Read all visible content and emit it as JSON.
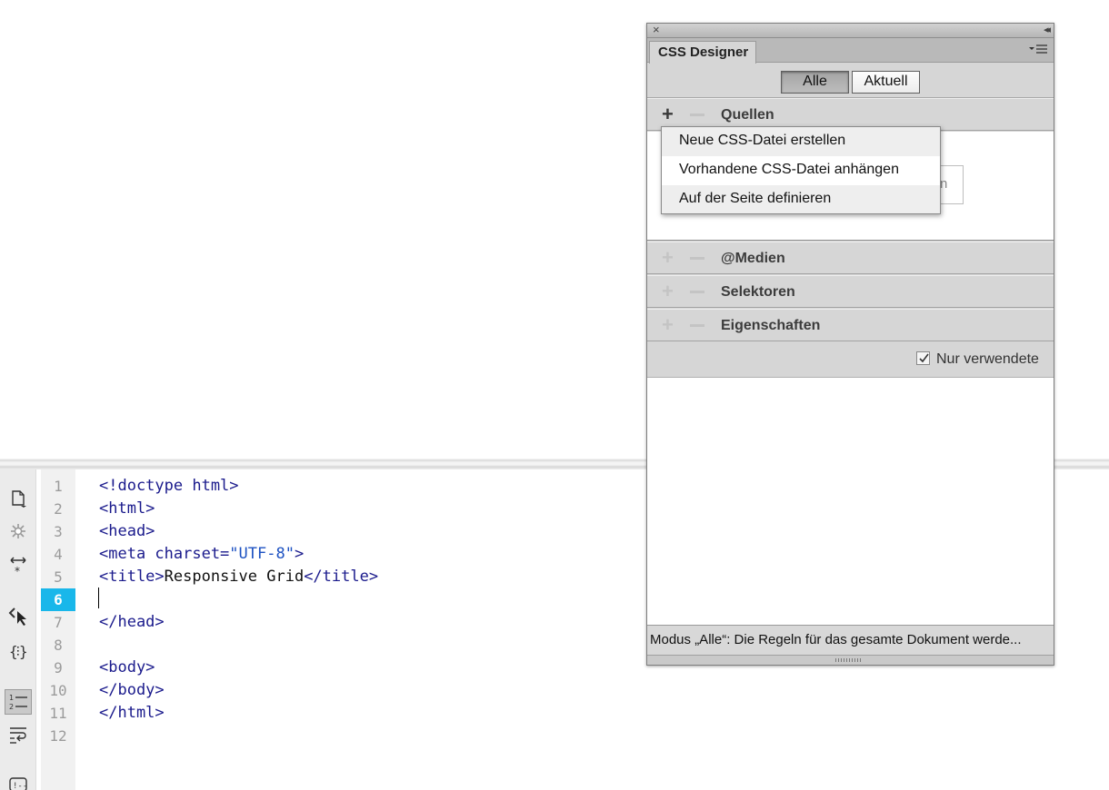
{
  "editor": {
    "line_numbers": [
      "1",
      "2",
      "3",
      "4",
      "5",
      "6",
      "7",
      "8",
      "9",
      "10",
      "11",
      "12"
    ],
    "current_line": "6",
    "code": {
      "l1": "<!doctype html>",
      "l2": "<html>",
      "l3": "<head>",
      "l4_tag_open": "<meta charset=",
      "l4_value": "\"UTF-8\"",
      "l4_tag_close": ">",
      "l5_open": "<title>",
      "l5_text": "Responsive Grid",
      "l5_close": "</title>",
      "l7": "</head>",
      "l9": "<body>",
      "l10": "</body>",
      "l11": "</html>"
    },
    "toolbar_icons": [
      "open-documents-icon",
      "collapse-tag-icon",
      "expand-all-icon",
      "select-parent-tag-icon",
      "balance-braces-icon",
      "line-numbers-icon",
      "word-wrap-icon",
      "apply-comment-icon"
    ]
  },
  "css_designer": {
    "close_glyph": "×",
    "collapse_glyph": "◂◂",
    "tab_label": "CSS Designer",
    "toggle_all": "Alle",
    "toggle_current": "Aktuell",
    "sections": {
      "sources": "Quellen",
      "media": "@Medien",
      "selectors": "Selektoren",
      "properties": "Eigenschaften"
    },
    "plus_glyph": "+",
    "hidden_fragment": "n",
    "only_used_label": "Nur verwendete",
    "only_used_checked": true,
    "status_text": "Modus „Alle“: Die Regeln für das gesamte Dokument werde..."
  },
  "add_source_menu": {
    "items": [
      "Neue CSS-Datei erstellen",
      "Vorhandene CSS-Datei anhängen",
      "Auf der Seite definieren"
    ],
    "highlighted_index": 1
  },
  "colors": {
    "current_line_highlight": "#19b7ea",
    "code_tag": "#1a1a8c",
    "code_value": "#1d52c2"
  }
}
